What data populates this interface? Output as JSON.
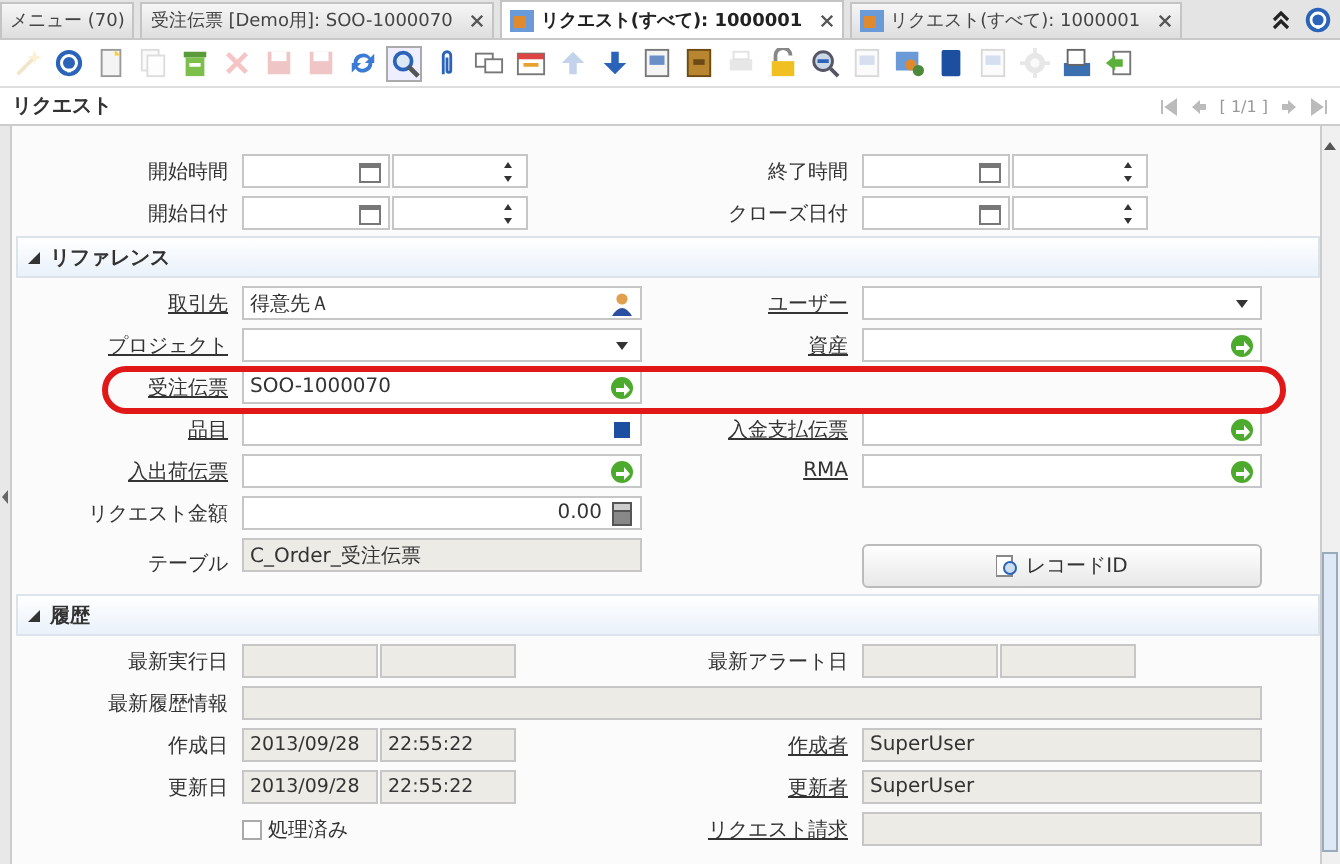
{
  "tabs": [
    {
      "label": "メニュー (70)",
      "selected": false,
      "closable": false,
      "icon": false
    },
    {
      "label": "受注伝票 [Demo用]: SOO-1000070",
      "selected": false,
      "closable": true,
      "icon": false
    },
    {
      "label": "リクエスト(すべて): 1000001",
      "selected": true,
      "closable": true,
      "icon": true
    },
    {
      "label": "リクエスト(すべて): 1000001",
      "selected": false,
      "closable": true,
      "icon": true
    }
  ],
  "toolbar": [
    {
      "kind": "wand",
      "disabled": true,
      "selected": false
    },
    {
      "kind": "help",
      "disabled": false,
      "selected": false
    },
    {
      "kind": "new",
      "disabled": false,
      "selected": false
    },
    {
      "kind": "copy",
      "disabled": true,
      "selected": false
    },
    {
      "kind": "delete",
      "disabled": false,
      "selected": false
    },
    {
      "kind": "cancel",
      "disabled": true,
      "selected": false
    },
    {
      "kind": "save",
      "disabled": true,
      "selected": false
    },
    {
      "kind": "save",
      "disabled": true,
      "selected": false
    },
    {
      "kind": "refresh",
      "disabled": false,
      "selected": false
    },
    {
      "kind": "find",
      "disabled": false,
      "selected": true
    },
    {
      "kind": "attach",
      "disabled": false,
      "selected": false
    },
    {
      "kind": "chat",
      "disabled": false,
      "selected": false
    },
    {
      "kind": "grid",
      "disabled": false,
      "selected": false
    },
    {
      "kind": "up",
      "disabled": true,
      "selected": false
    },
    {
      "kind": "down",
      "disabled": false,
      "selected": false
    },
    {
      "kind": "report",
      "disabled": false,
      "selected": false
    },
    {
      "kind": "archive",
      "disabled": false,
      "selected": false
    },
    {
      "kind": "print",
      "disabled": true,
      "selected": false
    },
    {
      "kind": "lock",
      "disabled": false,
      "selected": false
    },
    {
      "kind": "zoom",
      "disabled": false,
      "selected": false
    },
    {
      "kind": "report",
      "disabled": true,
      "selected": false
    },
    {
      "kind": "workflow",
      "disabled": false,
      "selected": false
    },
    {
      "kind": "book",
      "disabled": false,
      "selected": false
    },
    {
      "kind": "report",
      "disabled": true,
      "selected": false
    },
    {
      "kind": "gear",
      "disabled": true,
      "selected": false
    },
    {
      "kind": "export",
      "disabled": false,
      "selected": false
    },
    {
      "kind": "import",
      "disabled": false,
      "selected": false
    }
  ],
  "title": "リクエスト",
  "record_nav": {
    "position": "[ 1/1 ]"
  },
  "sections": [
    {
      "rows": [
        {
          "left": {
            "label": "開始時間",
            "link": false,
            "kind": "datetime"
          },
          "right": {
            "label": "終了時間",
            "link": false,
            "kind": "datetime"
          }
        },
        {
          "left": {
            "label": "開始日付",
            "link": false,
            "kind": "datetime"
          },
          "right": {
            "label": "クローズ日付",
            "link": false,
            "kind": "datetime"
          }
        }
      ]
    },
    {
      "title": "リファレンス",
      "expanded": true,
      "rows": [
        {
          "left": {
            "label": "取引先",
            "link": true,
            "kind": "search",
            "value": "得意先Ａ"
          },
          "right": {
            "label": "ユーザー",
            "link": true,
            "kind": "select"
          }
        },
        {
          "left": {
            "label": "プロジェクト",
            "link": true,
            "kind": "select"
          },
          "right": {
            "label": "資産",
            "link": true,
            "kind": "lookup"
          }
        },
        {
          "left": {
            "label": "受注伝票",
            "link": true,
            "kind": "lookup",
            "value": "SOO-1000070"
          }
        },
        {
          "left": {
            "label": "品目",
            "link": true,
            "kind": "product"
          },
          "right": {
            "label": "入金支払伝票",
            "link": true,
            "kind": "lookup"
          }
        },
        {
          "left": {
            "label": "入出荷伝票",
            "link": true,
            "kind": "lookup"
          },
          "right": {
            "label": "RMA",
            "link": true,
            "kind": "lookup"
          }
        },
        {
          "left": {
            "label": "リクエスト金額",
            "link": false,
            "kind": "number",
            "value": "0.00"
          }
        },
        {
          "left": {
            "label": "テーブル",
            "link": false,
            "kind": "readonly",
            "value": "C_Order_受注伝票"
          },
          "right": {
            "kind": "button",
            "value": "レコードID"
          }
        }
      ]
    },
    {
      "title": "履歴",
      "expanded": true,
      "rows": [
        {
          "left": {
            "label": "最新実行日",
            "link": false,
            "kind": "pair"
          },
          "right": {
            "label": "最新アラート日",
            "link": false,
            "kind": "pair"
          }
        },
        {
          "left": {
            "label": "最新履歴情報",
            "link": false,
            "kind": "wide"
          }
        },
        {
          "left": {
            "label": "作成日",
            "link": false,
            "kind": "pair",
            "values": [
              "2013/09/28",
              "22:55:22"
            ]
          },
          "right": {
            "label": "作成者",
            "link": true,
            "kind": "readonly",
            "value": "SuperUser"
          }
        },
        {
          "left": {
            "label": "更新日",
            "link": false,
            "kind": "pair",
            "values": [
              "2013/09/28",
              "22:55:22"
            ]
          },
          "right": {
            "label": "更新者",
            "link": true,
            "kind": "readonly",
            "value": "SuperUser"
          }
        },
        {
          "left": {
            "kind": "checkbox",
            "value": "処理済み",
            "checked": false
          },
          "right": {
            "label": "リクエスト請求",
            "link": true,
            "kind": "readonly"
          }
        }
      ]
    }
  ],
  "highlight": {
    "kind": "ellipse"
  }
}
